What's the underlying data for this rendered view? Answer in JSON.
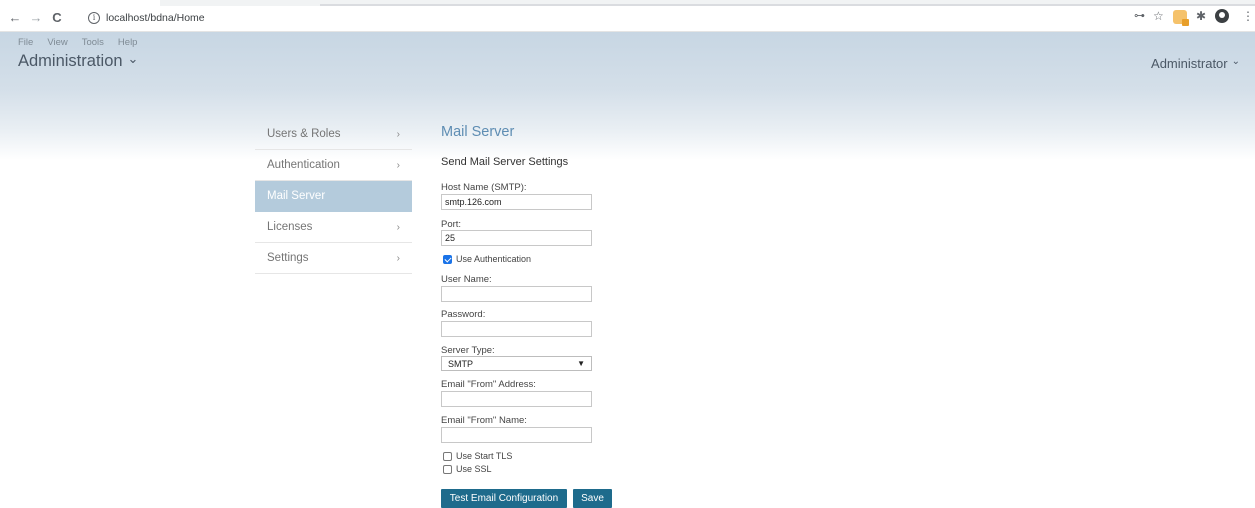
{
  "browser": {
    "back_icon": "←",
    "forward_icon": "→",
    "reload_icon": "C",
    "info_icon": "i",
    "url": "localhost/bdna/Home",
    "key_icon": "⊶",
    "star_icon": "☆",
    "puzzle_icon": "✱",
    "more_icon": "⋮"
  },
  "header": {
    "menu": [
      "File",
      "View",
      "Tools",
      "Help"
    ],
    "title": "Administration",
    "title_chevron": "⌄",
    "user": "Administrator",
    "user_chevron": "⌄"
  },
  "sidebar": {
    "items": [
      {
        "label": "Users & Roles",
        "chevron": "›"
      },
      {
        "label": "Authentication",
        "chevron": "›"
      },
      {
        "label": "Mail Server",
        "chevron": ""
      },
      {
        "label": "Licenses",
        "chevron": "›"
      },
      {
        "label": "Settings",
        "chevron": "›"
      }
    ]
  },
  "main": {
    "title": "Mail Server",
    "section": "Send Mail Server Settings",
    "host_label": "Host Name (SMTP):",
    "host_value": "smtp.126.com",
    "port_label": "Port:",
    "port_value": "25",
    "use_auth_label": "Use Authentication",
    "username_label": "User Name:",
    "username_value": "",
    "password_label": "Password:",
    "password_value": "",
    "server_type_label": "Server Type:",
    "server_type_value": "SMTP",
    "from_address_label": "Email \"From\" Address:",
    "from_address_value": "",
    "from_name_label": "Email \"From\" Name:",
    "from_name_value": "",
    "start_tls_label": "Use Start TLS",
    "ssl_label": "Use SSL",
    "test_button": "Test Email Configuration",
    "save_button": "Save"
  },
  "colors": {
    "accent_title": "#5e8db3",
    "sidebar_active": "#b4cbdc",
    "button": "#1e6b8c"
  }
}
